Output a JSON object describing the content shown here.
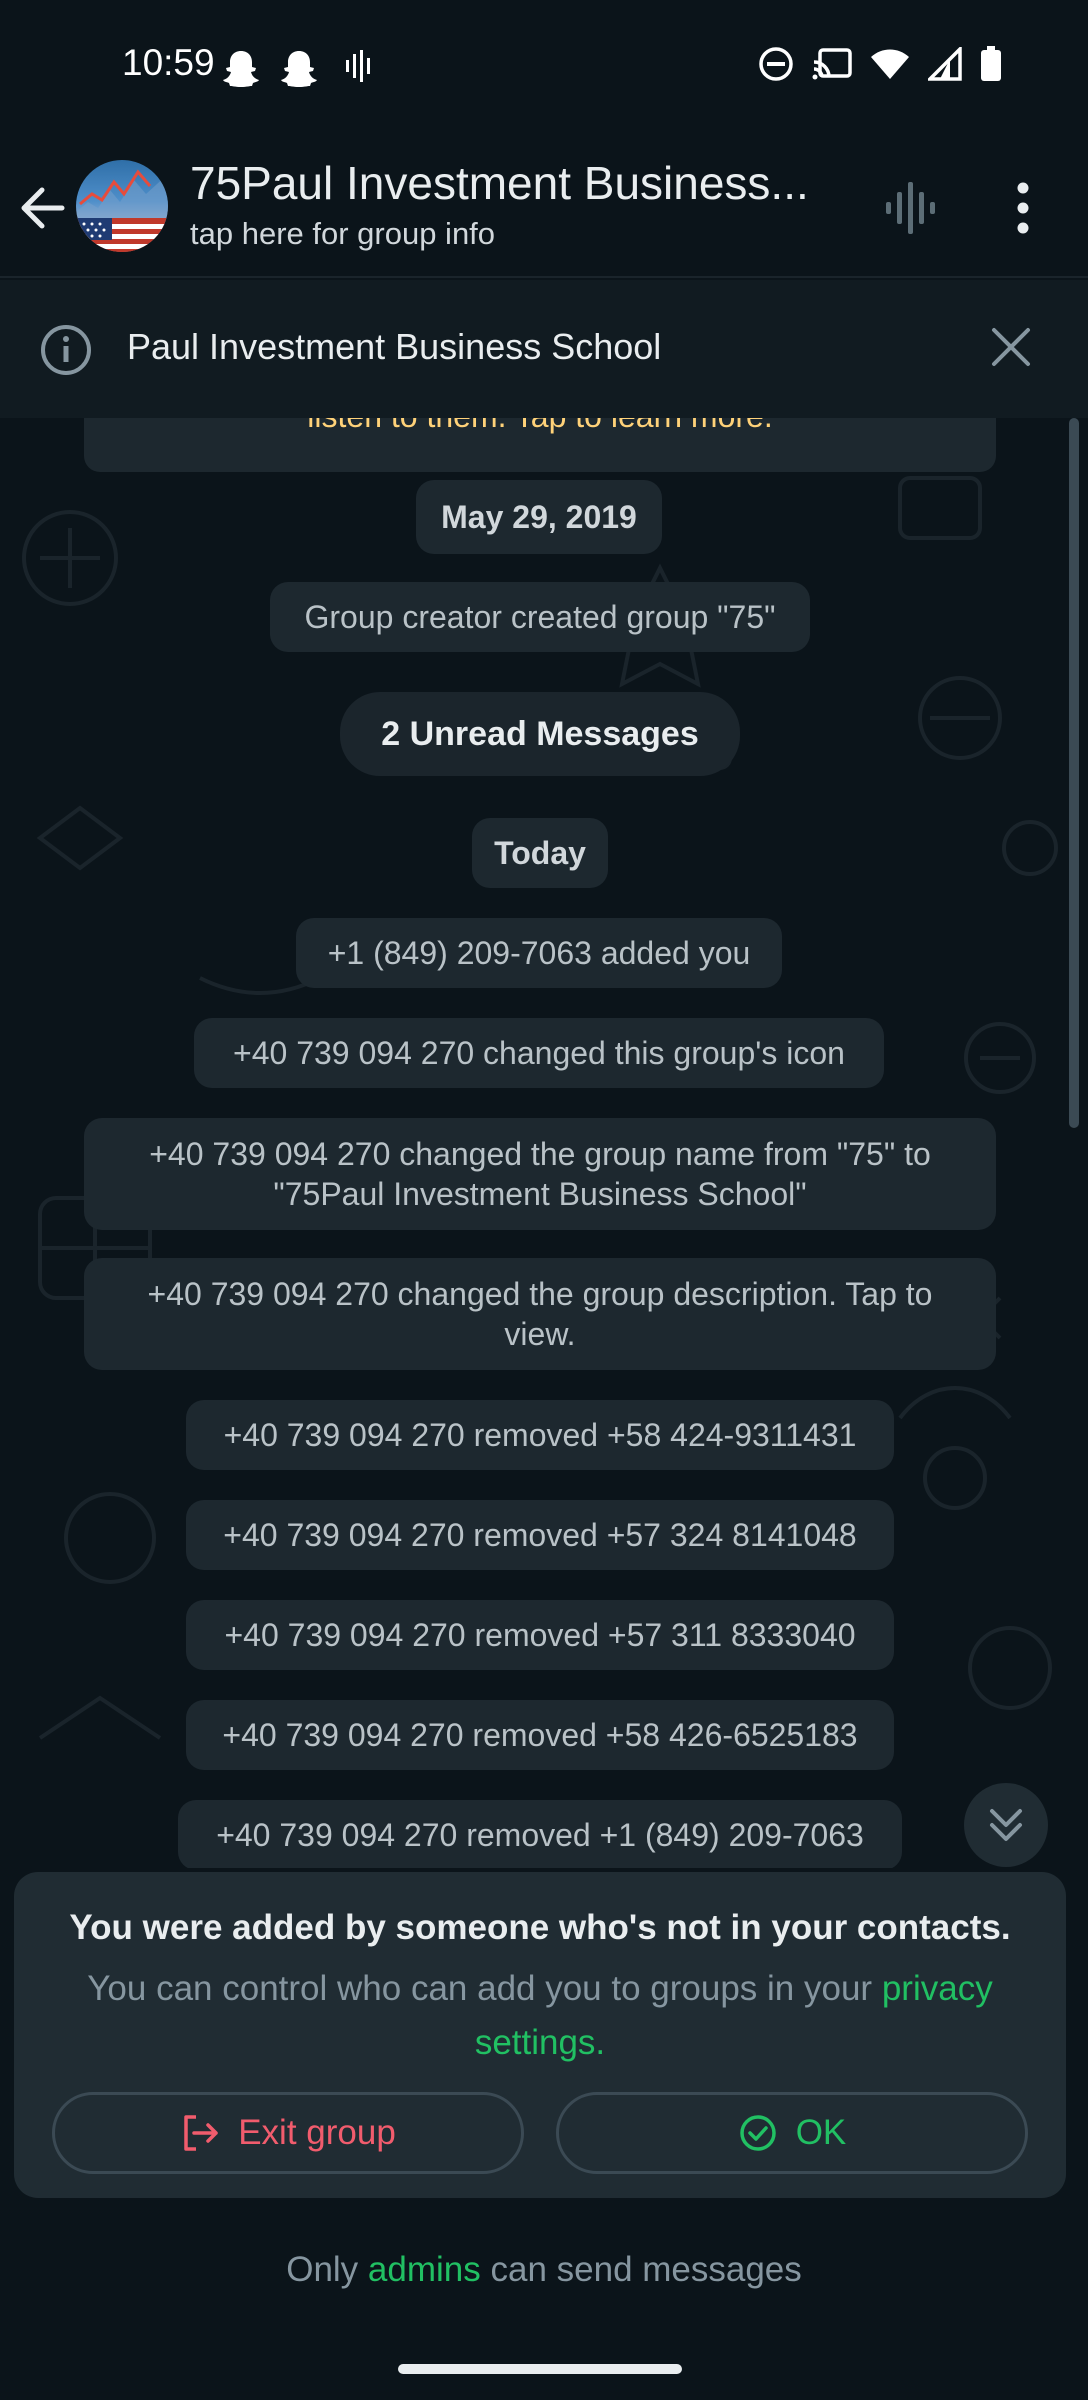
{
  "status_bar": {
    "time": "10:59"
  },
  "header": {
    "title": "75Paul Investment Business...",
    "subtitle": "tap here for group info"
  },
  "info_banner": {
    "text": "Paul Investment Business School"
  },
  "chat": {
    "encryption_tail": "listen to them. Tap to learn more.",
    "date_old": "May 29, 2019",
    "created": "Group creator created group \"75\"",
    "unread": "2 Unread Messages",
    "date_today": "Today",
    "messages": [
      "+1 (849) 209-7063 added you",
      "+40 739 094 270 changed this group's icon",
      "+40 739 094 270 changed the group name from \"75\" to",
      "\"75Paul Investment Business School\"",
      "+40 739 094 270 changed the group description. Tap to",
      "view.",
      "+40 739 094 270 removed +58 424-9311431",
      "+40 739 094 270 removed +57 324 8141048",
      "+40 739 094 270 removed +57 311 8333040",
      "+40 739 094 270 removed +58 426-6525183",
      "+40 739 094 270 removed +1 (849) 209-7063"
    ]
  },
  "popup": {
    "title": "You were added by someone who's not in your contacts.",
    "body": "You can control who can add you to groups in your",
    "link": "privacy settings.",
    "exit_label": "Exit group",
    "ok_label": "OK"
  },
  "footer": {
    "prefix": "Only",
    "link": "admins",
    "suffix": "can send messages"
  },
  "colors": {
    "background": "#0b141a",
    "bubble": "#1d282f",
    "accent_green": "#21c063",
    "danger_red": "#f15c6d",
    "encryption_yellow": "#ffd279"
  }
}
